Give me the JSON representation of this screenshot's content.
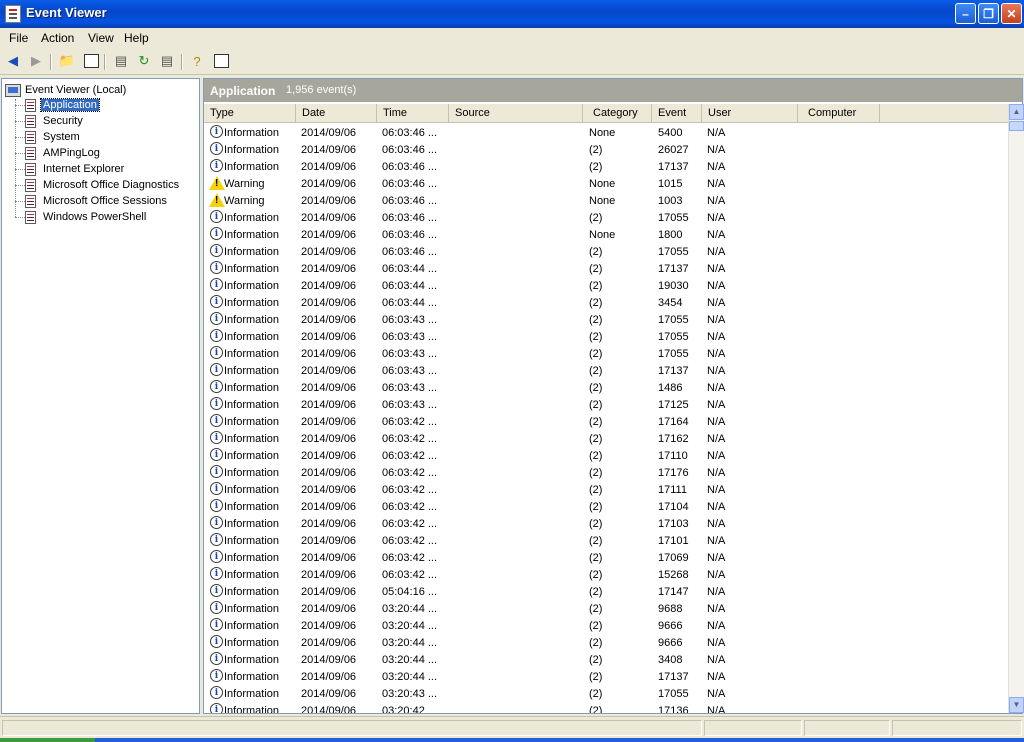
{
  "window": {
    "title": "Event Viewer"
  },
  "menu": [
    "File",
    "Action",
    "View",
    "Help"
  ],
  "toolbar_icons": [
    "back-icon",
    "forward-icon",
    "up-folder-icon",
    "show-hide-tree-icon",
    "properties-icon",
    "refresh-icon",
    "export-list-icon",
    "help-icon",
    "console-pane-icon"
  ],
  "tree": {
    "root": "Event Viewer (Local)",
    "items": [
      "Application",
      "Security",
      "System",
      "AMPingLog",
      "Internet Explorer",
      "Microsoft Office Diagnostics",
      "Microsoft Office Sessions",
      "Windows PowerShell"
    ],
    "selected": "Application"
  },
  "pane": {
    "log_name": "Application",
    "event_count": "1,956 event(s)"
  },
  "columns": [
    "Type",
    "Date",
    "Time",
    "Source",
    "Category",
    "Event",
    "User",
    "Computer"
  ],
  "rows": [
    {
      "type": "Information",
      "date": "2014/09/06",
      "time": "06:03:46 ...",
      "source": "",
      "category": "None",
      "event": "5400",
      "user": "N/A",
      "computer": ""
    },
    {
      "type": "Information",
      "date": "2014/09/06",
      "time": "06:03:46 ...",
      "source": "",
      "category": "(2)",
      "event": "26027",
      "user": "N/A",
      "computer": ""
    },
    {
      "type": "Information",
      "date": "2014/09/06",
      "time": "06:03:46 ...",
      "source": "",
      "category": "(2)",
      "event": "17137",
      "user": "N/A",
      "computer": ""
    },
    {
      "type": "Warning",
      "date": "2014/09/06",
      "time": "06:03:46 ...",
      "source": "",
      "category": "None",
      "event": "1015",
      "user": "N/A",
      "computer": ""
    },
    {
      "type": "Warning",
      "date": "2014/09/06",
      "time": "06:03:46 ...",
      "source": "",
      "category": "None",
      "event": "1003",
      "user": "N/A",
      "computer": ""
    },
    {
      "type": "Information",
      "date": "2014/09/06",
      "time": "06:03:46 ...",
      "source": "",
      "category": "(2)",
      "event": "17055",
      "user": "N/A",
      "computer": ""
    },
    {
      "type": "Information",
      "date": "2014/09/06",
      "time": "06:03:46 ...",
      "source": "",
      "category": "None",
      "event": "1800",
      "user": "N/A",
      "computer": ""
    },
    {
      "type": "Information",
      "date": "2014/09/06",
      "time": "06:03:46 ...",
      "source": "",
      "category": "(2)",
      "event": "17055",
      "user": "N/A",
      "computer": ""
    },
    {
      "type": "Information",
      "date": "2014/09/06",
      "time": "06:03:44 ...",
      "source": "",
      "category": "(2)",
      "event": "17137",
      "user": "N/A",
      "computer": ""
    },
    {
      "type": "Information",
      "date": "2014/09/06",
      "time": "06:03:44 ...",
      "source": "",
      "category": "(2)",
      "event": "19030",
      "user": "N/A",
      "computer": ""
    },
    {
      "type": "Information",
      "date": "2014/09/06",
      "time": "06:03:44 ...",
      "source": "",
      "category": "(2)",
      "event": "3454",
      "user": "N/A",
      "computer": ""
    },
    {
      "type": "Information",
      "date": "2014/09/06",
      "time": "06:03:43 ...",
      "source": "",
      "category": "(2)",
      "event": "17055",
      "user": "N/A",
      "computer": ""
    },
    {
      "type": "Information",
      "date": "2014/09/06",
      "time": "06:03:43 ...",
      "source": "",
      "category": "(2)",
      "event": "17055",
      "user": "N/A",
      "computer": ""
    },
    {
      "type": "Information",
      "date": "2014/09/06",
      "time": "06:03:43 ...",
      "source": "",
      "category": "(2)",
      "event": "17055",
      "user": "N/A",
      "computer": ""
    },
    {
      "type": "Information",
      "date": "2014/09/06",
      "time": "06:03:43 ...",
      "source": "",
      "category": "(2)",
      "event": "17137",
      "user": "N/A",
      "computer": ""
    },
    {
      "type": "Information",
      "date": "2014/09/06",
      "time": "06:03:43 ...",
      "source": "",
      "category": "(2)",
      "event": "1486",
      "user": "N/A",
      "computer": ""
    },
    {
      "type": "Information",
      "date": "2014/09/06",
      "time": "06:03:43 ...",
      "source": "",
      "category": "(2)",
      "event": "17125",
      "user": "N/A",
      "computer": ""
    },
    {
      "type": "Information",
      "date": "2014/09/06",
      "time": "06:03:42 ...",
      "source": "",
      "category": "(2)",
      "event": "17164",
      "user": "N/A",
      "computer": ""
    },
    {
      "type": "Information",
      "date": "2014/09/06",
      "time": "06:03:42 ...",
      "source": "",
      "category": "(2)",
      "event": "17162",
      "user": "N/A",
      "computer": ""
    },
    {
      "type": "Information",
      "date": "2014/09/06",
      "time": "06:03:42 ...",
      "source": "",
      "category": "(2)",
      "event": "17110",
      "user": "N/A",
      "computer": ""
    },
    {
      "type": "Information",
      "date": "2014/09/06",
      "time": "06:03:42 ...",
      "source": "",
      "category": "(2)",
      "event": "17176",
      "user": "N/A",
      "computer": ""
    },
    {
      "type": "Information",
      "date": "2014/09/06",
      "time": "06:03:42 ...",
      "source": "",
      "category": "(2)",
      "event": "17111",
      "user": "N/A",
      "computer": ""
    },
    {
      "type": "Information",
      "date": "2014/09/06",
      "time": "06:03:42 ...",
      "source": "",
      "category": "(2)",
      "event": "17104",
      "user": "N/A",
      "computer": ""
    },
    {
      "type": "Information",
      "date": "2014/09/06",
      "time": "06:03:42 ...",
      "source": "",
      "category": "(2)",
      "event": "17103",
      "user": "N/A",
      "computer": ""
    },
    {
      "type": "Information",
      "date": "2014/09/06",
      "time": "06:03:42 ...",
      "source": "",
      "category": "(2)",
      "event": "17101",
      "user": "N/A",
      "computer": ""
    },
    {
      "type": "Information",
      "date": "2014/09/06",
      "time": "06:03:42 ...",
      "source": "",
      "category": "(2)",
      "event": "17069",
      "user": "N/A",
      "computer": ""
    },
    {
      "type": "Information",
      "date": "2014/09/06",
      "time": "06:03:42 ...",
      "source": "",
      "category": "(2)",
      "event": "15268",
      "user": "N/A",
      "computer": ""
    },
    {
      "type": "Information",
      "date": "2014/09/06",
      "time": "05:04:16 ...",
      "source": "",
      "category": "(2)",
      "event": "17147",
      "user": "N/A",
      "computer": ""
    },
    {
      "type": "Information",
      "date": "2014/09/06",
      "time": "03:20:44 ...",
      "source": "",
      "category": "(2)",
      "event": "9688",
      "user": "N/A",
      "computer": ""
    },
    {
      "type": "Information",
      "date": "2014/09/06",
      "time": "03:20:44 ...",
      "source": "",
      "category": "(2)",
      "event": "9666",
      "user": "N/A",
      "computer": ""
    },
    {
      "type": "Information",
      "date": "2014/09/06",
      "time": "03:20:44 ...",
      "source": "",
      "category": "(2)",
      "event": "9666",
      "user": "N/A",
      "computer": ""
    },
    {
      "type": "Information",
      "date": "2014/09/06",
      "time": "03:20:44 ...",
      "source": "",
      "category": "(2)",
      "event": "3408",
      "user": "N/A",
      "computer": ""
    },
    {
      "type": "Information",
      "date": "2014/09/06",
      "time": "03:20:44 ...",
      "source": "",
      "category": "(2)",
      "event": "17137",
      "user": "N/A",
      "computer": ""
    },
    {
      "type": "Information",
      "date": "2014/09/06",
      "time": "03:20:43 ...",
      "source": "",
      "category": "(2)",
      "event": "17055",
      "user": "N/A",
      "computer": ""
    },
    {
      "type": "Information",
      "date": "2014/09/06",
      "time": "03:20:42",
      "source": "",
      "category": "(2)",
      "event": "17136",
      "user": "N/A",
      "computer": ""
    }
  ],
  "colors": {
    "title_bar": "#0553e2",
    "selection": "#316ac5",
    "pane_header": "#a7a69c",
    "chrome": "#ece9d8"
  }
}
